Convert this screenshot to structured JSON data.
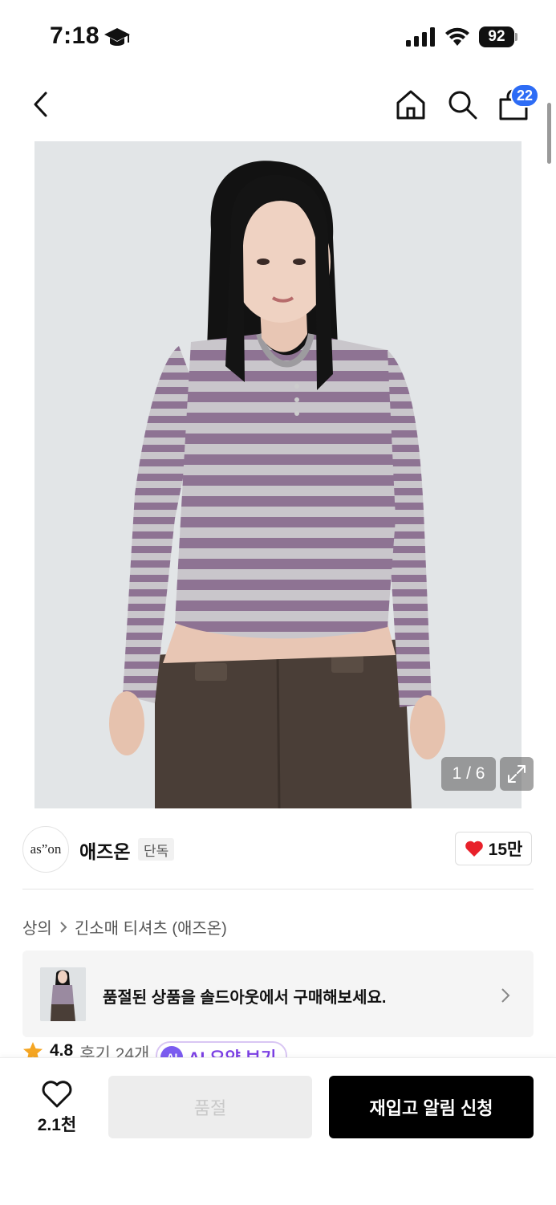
{
  "status_bar": {
    "time": "7:18",
    "battery": "92"
  },
  "nav": {
    "cart_count": "22"
  },
  "gallery": {
    "counter": "1 / 6"
  },
  "brand": {
    "logo_text": "as”on",
    "name": "애즈온",
    "tag": "단독",
    "likes": "15만"
  },
  "breadcrumb": {
    "items": [
      "상의",
      "긴소매 티셔츠 (애즈온)"
    ]
  },
  "soldout_banner": {
    "text": "품절된 상품을 솔드아웃에서 구매해보세요."
  },
  "rating": {
    "score": "4.8",
    "reviews": "후기 24개",
    "ai_badge": "AI",
    "ai_label": "AI 요약 보기"
  },
  "bottom_bar": {
    "wish_count": "2.1천",
    "soldout_label": "품절",
    "restock_label": "재입고 알림 신청"
  },
  "colors": {
    "accent_blue": "#2d6cf5",
    "heart_red": "#e8202a",
    "ai_purple": "#7b3fe4",
    "primary_black": "#000000"
  }
}
